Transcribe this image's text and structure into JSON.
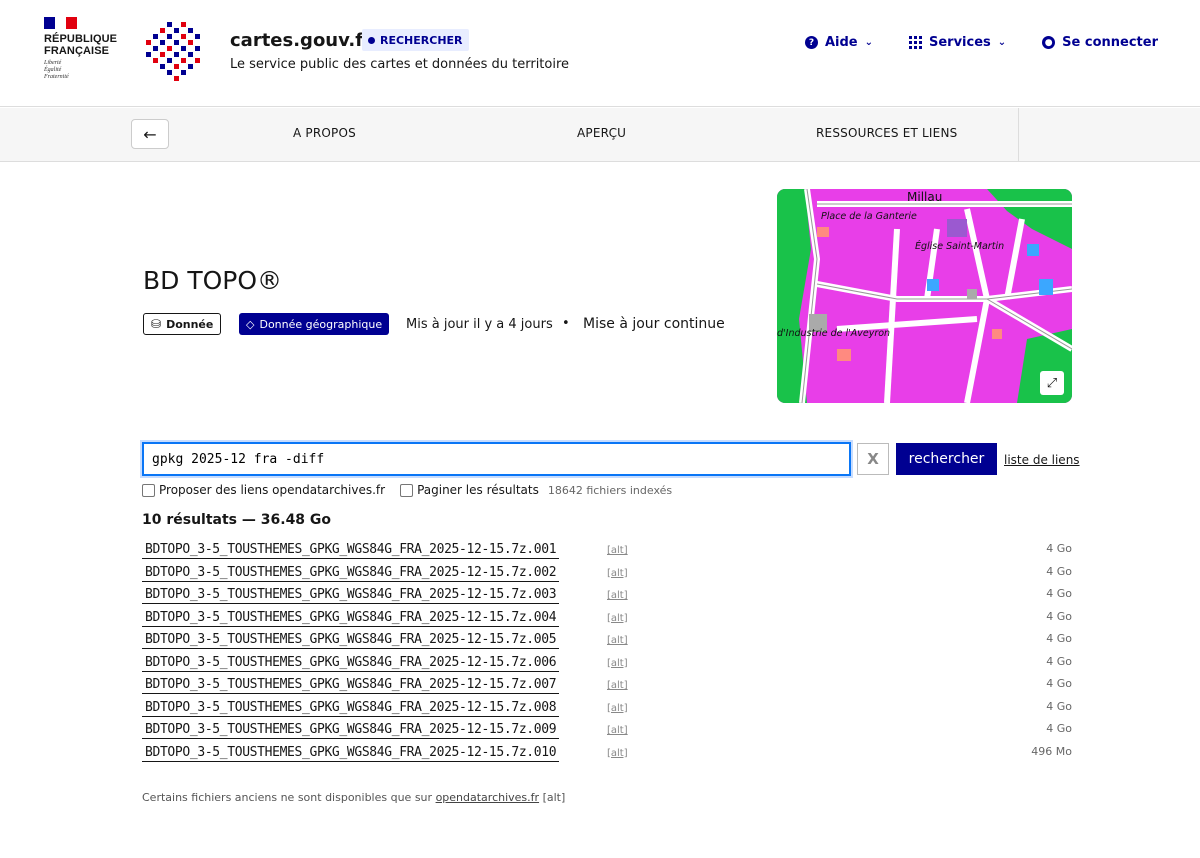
{
  "header": {
    "republic_line1": "RÉPUBLIQUE",
    "republic_line2": "FRANÇAISE",
    "motto_1": "Liberté",
    "motto_2": "Égalité",
    "motto_3": "Fraternité",
    "site_title": "cartes.gouv.fr",
    "search_label": "RECHERCHER",
    "tagline": "Le service public des cartes et données du territoire",
    "nav": {
      "help": "Aide",
      "services": "Services",
      "login": "Se connecter"
    },
    "colors": {
      "brand_blue": "#000091",
      "flag_red": "#e1000f"
    }
  },
  "subnav": {
    "back_icon": "arrow-left-icon",
    "links": [
      "A PROPOS",
      "APERÇU",
      "RESSOURCES ET LIENS"
    ]
  },
  "dataset": {
    "title": "BD TOPO®",
    "badge_data": "Donnée",
    "badge_geo": "Donnée géographique",
    "updated": "Mis à jour  il y a 4 jours",
    "bullet": "•",
    "update_mode": "Mise à jour continue"
  },
  "map": {
    "labels": {
      "city": "Millau",
      "place": "Place de la Ganterie",
      "church": "Église Saint-Martin",
      "street": "d'Industrie de l'Aveyron"
    },
    "expand_icon": "expand-icon"
  },
  "search": {
    "value": "gpkg 2025-12 fra -diff",
    "clear_label": "X",
    "submit_label": "rechercher",
    "links_list_label": "liste de liens",
    "option_archives": "Proposer des liens opendatarchives.fr",
    "option_paginate": "Paginer les résultats",
    "indexed": "18642 fichiers indexés"
  },
  "results": {
    "summary": "10 résultats — 36.48 Go",
    "alt_label": "[alt]",
    "items": [
      {
        "name": "BDTOPO_3-5_TOUSTHEMES_GPKG_WGS84G_FRA_2025-12-15.7z.001",
        "size": "4 Go"
      },
      {
        "name": "BDTOPO_3-5_TOUSTHEMES_GPKG_WGS84G_FRA_2025-12-15.7z.002",
        "size": "4 Go"
      },
      {
        "name": "BDTOPO_3-5_TOUSTHEMES_GPKG_WGS84G_FRA_2025-12-15.7z.003",
        "size": "4 Go"
      },
      {
        "name": "BDTOPO_3-5_TOUSTHEMES_GPKG_WGS84G_FRA_2025-12-15.7z.004",
        "size": "4 Go"
      },
      {
        "name": "BDTOPO_3-5_TOUSTHEMES_GPKG_WGS84G_FRA_2025-12-15.7z.005",
        "size": "4 Go"
      },
      {
        "name": "BDTOPO_3-5_TOUSTHEMES_GPKG_WGS84G_FRA_2025-12-15.7z.006",
        "size": "4 Go"
      },
      {
        "name": "BDTOPO_3-5_TOUSTHEMES_GPKG_WGS84G_FRA_2025-12-15.7z.007",
        "size": "4 Go"
      },
      {
        "name": "BDTOPO_3-5_TOUSTHEMES_GPKG_WGS84G_FRA_2025-12-15.7z.008",
        "size": "4 Go"
      },
      {
        "name": "BDTOPO_3-5_TOUSTHEMES_GPKG_WGS84G_FRA_2025-12-15.7z.009",
        "size": "4 Go"
      },
      {
        "name": "BDTOPO_3-5_TOUSTHEMES_GPKG_WGS84G_FRA_2025-12-15.7z.010",
        "size": "496 Mo"
      }
    ]
  },
  "footnote": {
    "text": "Certains fichiers anciens ne sont disponibles que sur",
    "link": "opendatarchives.fr",
    "alt": "[alt]"
  }
}
